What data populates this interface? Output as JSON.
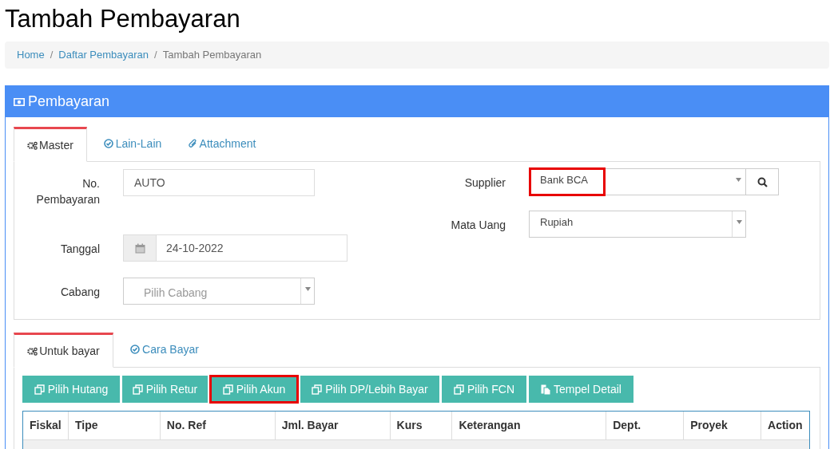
{
  "page_title": "Tambah Pembayaran",
  "breadcrumb": [
    {
      "label": "Home",
      "kind": "link"
    },
    {
      "label": "Daftar Pembayaran",
      "kind": "link",
      "separator": "/"
    },
    {
      "label": "Tambah Pembayaran",
      "kind": "current",
      "separator": "/"
    }
  ],
  "panel": {
    "title": "Pembayaran"
  },
  "master_tabs": [
    {
      "label": "Master",
      "selected": true
    },
    {
      "label": "Lain-Lain",
      "selected": false
    },
    {
      "label": "Attachment",
      "selected": false
    }
  ],
  "left_fields": [
    {
      "label": "No. Pembayaran",
      "kind": "text",
      "value": "AUTO"
    },
    {
      "label": "Tanggal",
      "kind": "date",
      "value": "24-10-2022"
    },
    {
      "label": "Cabang",
      "kind": "select",
      "placeholder": "Pilih Cabang"
    }
  ],
  "right_fields": [
    {
      "label": "Supplier",
      "kind": "select-search",
      "value": "Bank BCA",
      "highlighted": true
    },
    {
      "label": "Mata Uang",
      "kind": "select",
      "value": "Rupiah",
      "highlighted": false
    }
  ],
  "detail_tabs": [
    {
      "label": "Untuk bayar",
      "selected": true
    },
    {
      "label": "Cara Bayar",
      "selected": false
    }
  ],
  "buttons": [
    {
      "label": "Pilih Hutang",
      "highlighted": false
    },
    {
      "label": "Pilih Retur",
      "highlighted": false
    },
    {
      "label": "Pilih Akun",
      "highlighted": true
    },
    {
      "label": "Pilih DP/Lebih Bayar",
      "highlighted": false
    },
    {
      "label": "Pilih FCN",
      "highlighted": false
    },
    {
      "label": "Tempel Detail",
      "highlighted": false
    }
  ],
  "table": {
    "columns": [
      "Fiskal",
      "Tipe",
      "No. Ref",
      "Jml. Bayar",
      "Kurs",
      "Keterangan",
      "Dept.",
      "Proyek",
      "Action"
    ]
  }
}
